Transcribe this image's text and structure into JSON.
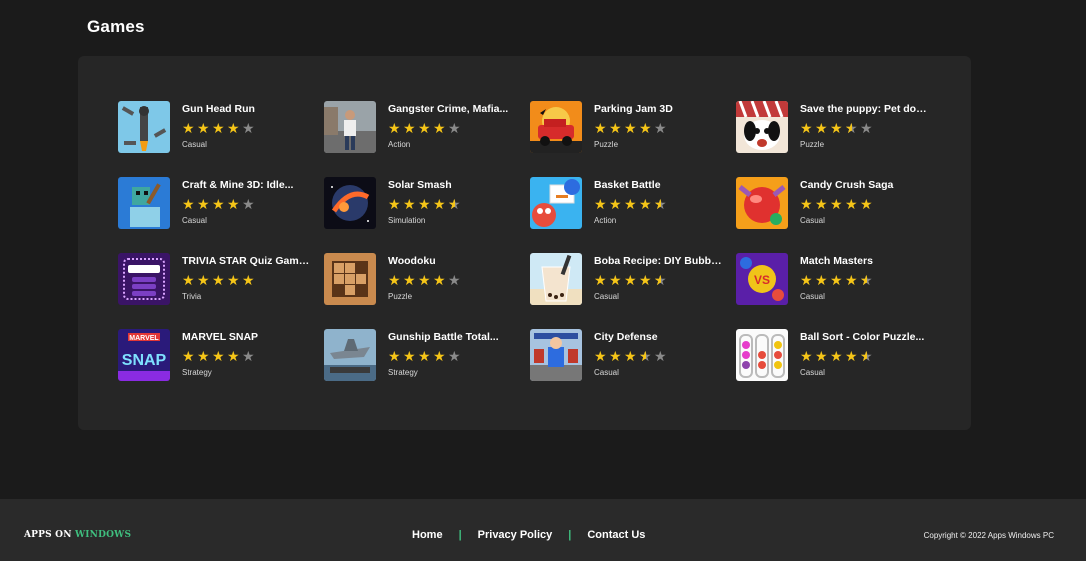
{
  "section_title": "Games",
  "colors": {
    "star": "#f5c518",
    "star_empty": "#8a8a8a",
    "accent": "#3fbf7f"
  },
  "games": [
    {
      "name": "Gun Head Run",
      "category": "Casual",
      "rating": 4,
      "icon": "gun-head-run-icon"
    },
    {
      "name": "Gangster Crime, Mafia...",
      "category": "Action",
      "rating": 4,
      "icon": "gangster-crime-icon"
    },
    {
      "name": "Parking Jam 3D",
      "category": "Puzzle",
      "rating": 4,
      "icon": "parking-jam-icon"
    },
    {
      "name": "Save the puppy: Pet dog...",
      "category": "Puzzle",
      "rating": 3.5,
      "icon": "save-the-puppy-icon"
    },
    {
      "name": "Craft & Mine 3D: Idle...",
      "category": "Casual",
      "rating": 4,
      "icon": "craft-mine-icon"
    },
    {
      "name": "Solar Smash",
      "category": "Simulation",
      "rating": 4.5,
      "icon": "solar-smash-icon"
    },
    {
      "name": "Basket Battle",
      "category": "Action",
      "rating": 4.5,
      "icon": "basket-battle-icon"
    },
    {
      "name": "Candy Crush Saga",
      "category": "Casual",
      "rating": 5,
      "icon": "candy-crush-icon"
    },
    {
      "name": "TRIVIA STAR Quiz Games...",
      "category": "Trivia",
      "rating": 5,
      "icon": "trivia-star-icon"
    },
    {
      "name": "Woodoku",
      "category": "Puzzle",
      "rating": 4,
      "icon": "woodoku-icon"
    },
    {
      "name": "Boba Recipe: DIY Bubble...",
      "category": "Casual",
      "rating": 4.5,
      "icon": "boba-recipe-icon"
    },
    {
      "name": "Match Masters",
      "category": "Casual",
      "rating": 4.5,
      "icon": "match-masters-icon"
    },
    {
      "name": "MARVEL SNAP",
      "category": "Strategy",
      "rating": 4,
      "icon": "marvel-snap-icon"
    },
    {
      "name": "Gunship Battle Total...",
      "category": "Strategy",
      "rating": 4,
      "icon": "gunship-battle-icon"
    },
    {
      "name": "City Defense",
      "category": "Casual",
      "rating": 3.5,
      "icon": "city-defense-icon"
    },
    {
      "name": "Ball Sort - Color Puzzle...",
      "category": "Casual",
      "rating": 4.5,
      "icon": "ball-sort-icon"
    }
  ],
  "footer": {
    "brand_part1": "APPS ON ",
    "brand_part2": "WINDOWS",
    "nav": [
      "Home",
      "Privacy Policy",
      "Contact Us"
    ],
    "copyright": "Copyright © 2022 Apps Windows PC"
  }
}
